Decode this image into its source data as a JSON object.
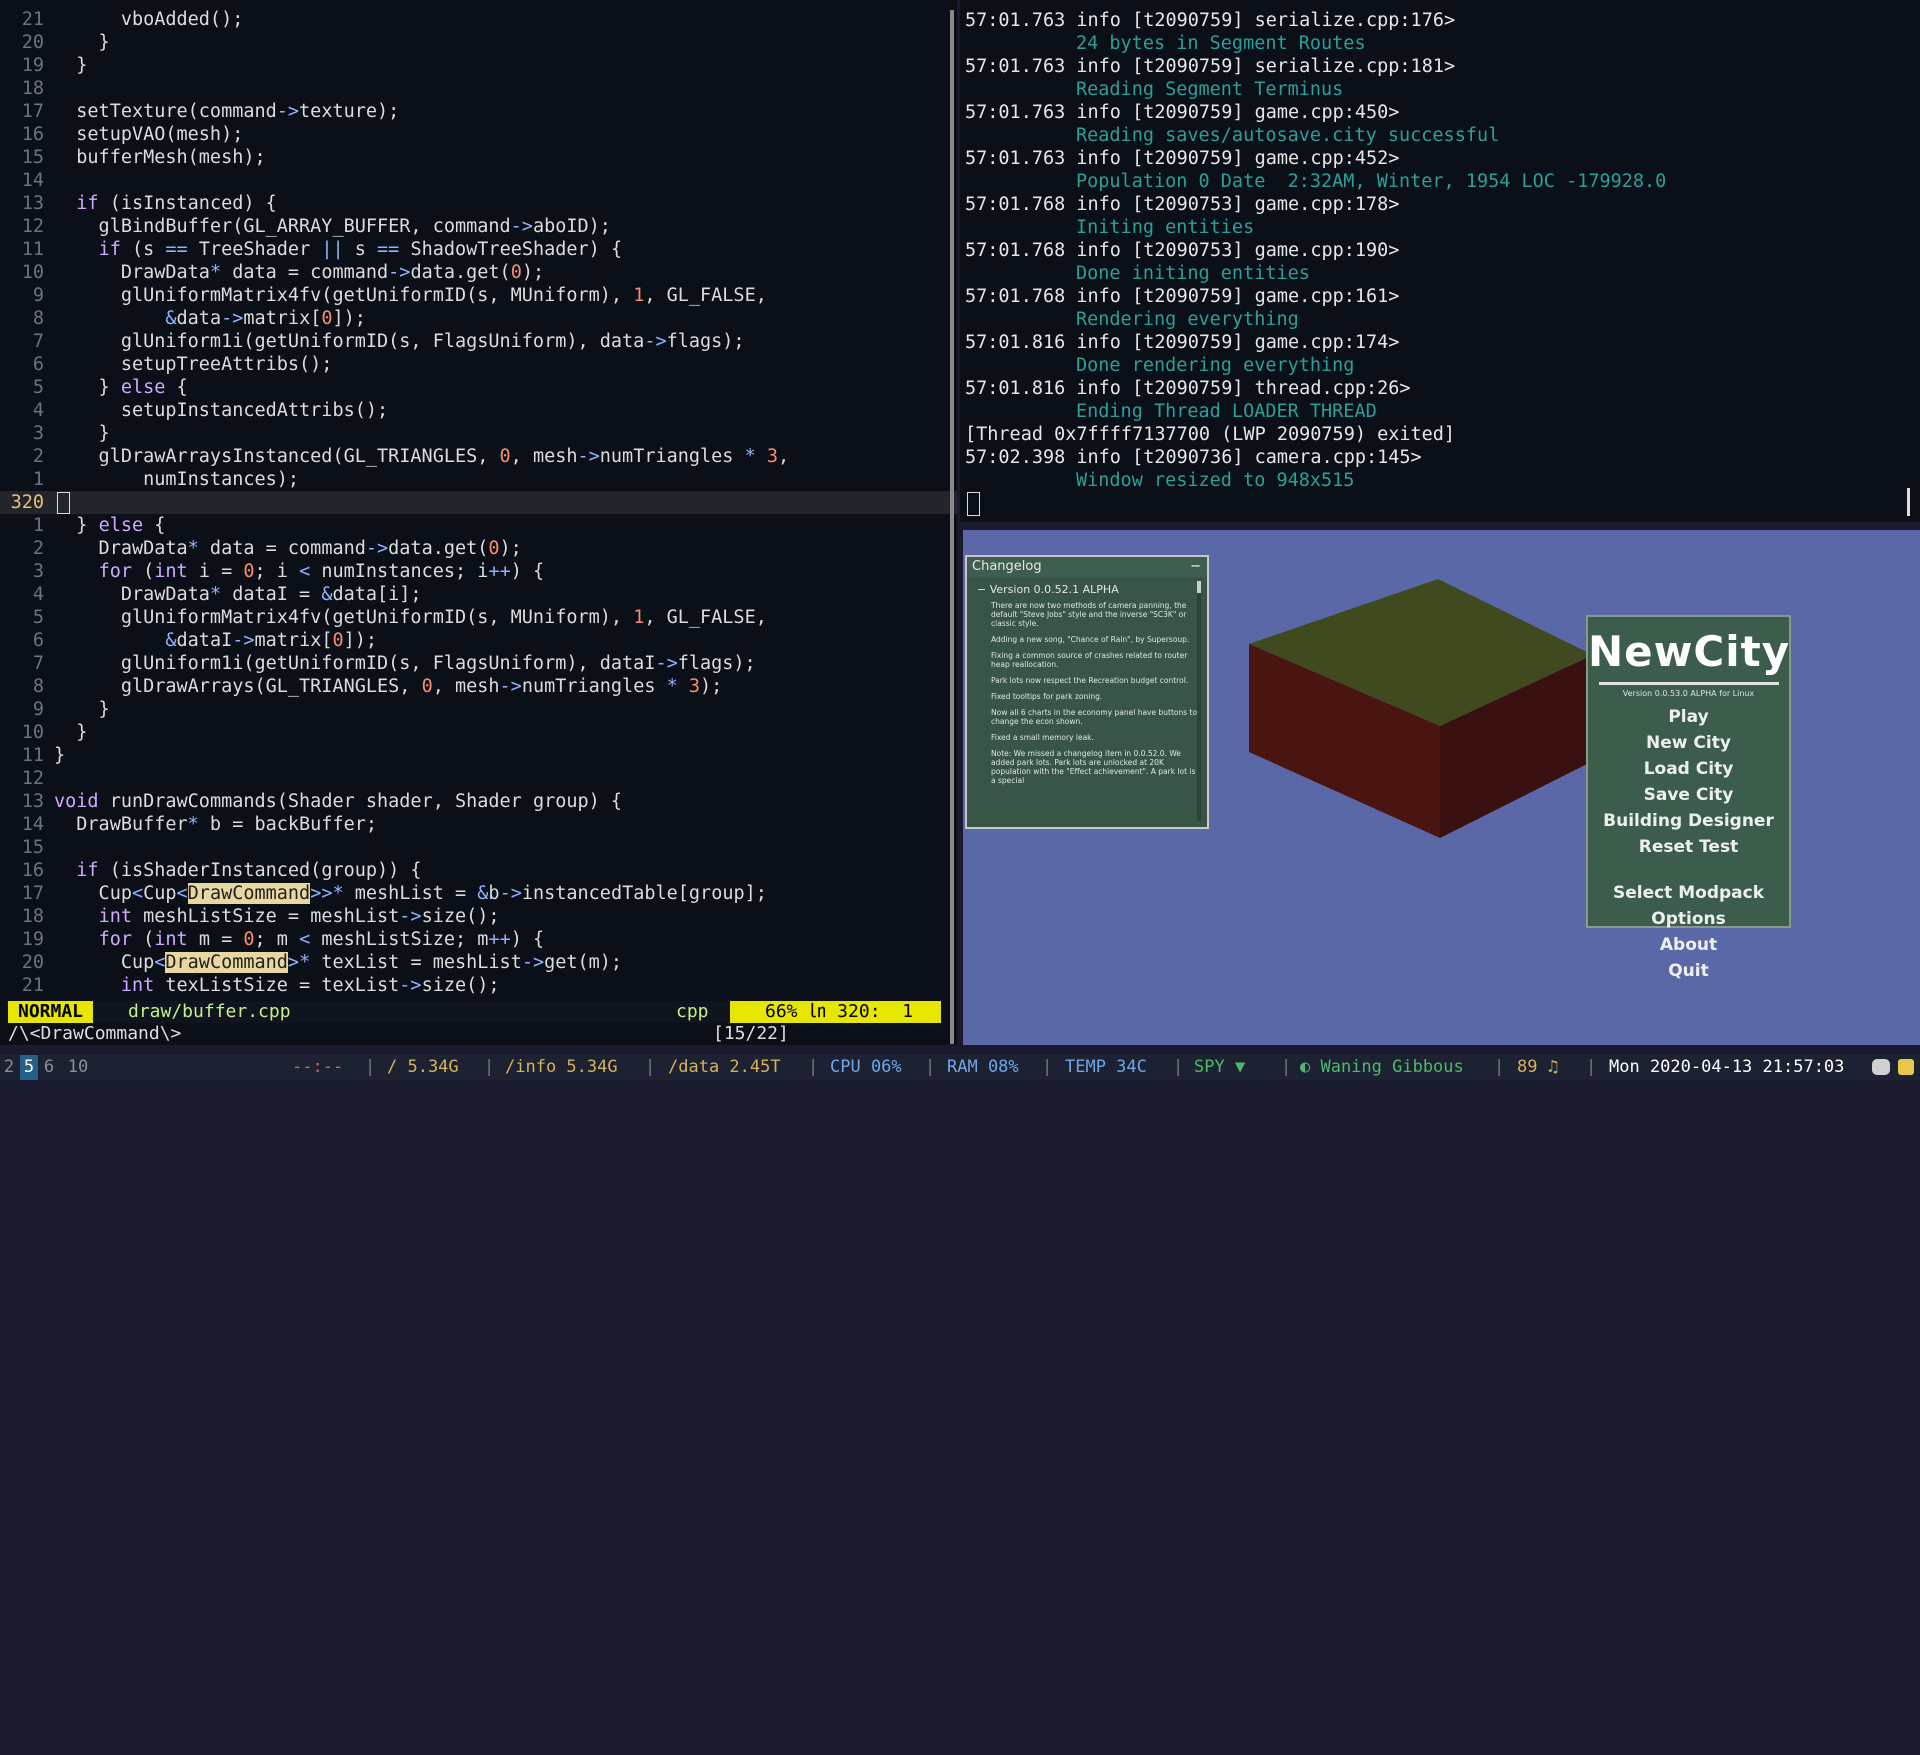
{
  "editor": {
    "lines": [
      {
        "n": "21",
        "code": "      vboAdded();"
      },
      {
        "n": "20",
        "code": "    }"
      },
      {
        "n": "19",
        "code": "  }"
      },
      {
        "n": "18",
        "code": ""
      },
      {
        "n": "17",
        "code": "  setTexture(command->texture);"
      },
      {
        "n": "16",
        "code": "  setupVAO(mesh);"
      },
      {
        "n": "15",
        "code": "  bufferMesh(mesh);"
      },
      {
        "n": "14",
        "code": ""
      },
      {
        "n": "13",
        "code": "  if (isInstanced) {"
      },
      {
        "n": "12",
        "code": "    glBindBuffer(GL_ARRAY_BUFFER, command->aboID);"
      },
      {
        "n": "11",
        "code": "    if (s == TreeShader || s == ShadowTreeShader) {"
      },
      {
        "n": "10",
        "code": "      DrawData* data = command->data.get(0);"
      },
      {
        "n": "9",
        "code": "      glUniformMatrix4fv(getUniformID(s, MUniform), 1, GL_FALSE,"
      },
      {
        "n": "8",
        "code": "          &data->matrix[0]);"
      },
      {
        "n": "7",
        "code": "      glUniform1i(getUniformID(s, FlagsUniform), data->flags);"
      },
      {
        "n": "6",
        "code": "      setupTreeAttribs();"
      },
      {
        "n": "5",
        "code": "    } else {"
      },
      {
        "n": "4",
        "code": "      setupInstancedAttribs();"
      },
      {
        "n": "3",
        "code": "    }"
      },
      {
        "n": "2",
        "code": "    glDrawArraysInstanced(GL_TRIANGLES, 0, mesh->numTriangles * 3,"
      },
      {
        "n": "1",
        "code": "        numInstances);"
      },
      {
        "n": "320",
        "code": "",
        "current": true
      },
      {
        "n": "1",
        "code": "  } else {"
      },
      {
        "n": "2",
        "code": "    DrawData* data = command->data.get(0);"
      },
      {
        "n": "3",
        "code": "    for (int i = 0; i < numInstances; i++) {"
      },
      {
        "n": "4",
        "code": "      DrawData* dataI = &data[i];"
      },
      {
        "n": "5",
        "code": "      glUniformMatrix4fv(getUniformID(s, MUniform), 1, GL_FALSE,"
      },
      {
        "n": "6",
        "code": "          &dataI->matrix[0]);"
      },
      {
        "n": "7",
        "code": "      glUniform1i(getUniformID(s, FlagsUniform), dataI->flags);"
      },
      {
        "n": "8",
        "code": "      glDrawArrays(GL_TRIANGLES, 0, mesh->numTriangles * 3);"
      },
      {
        "n": "9",
        "code": "    }"
      },
      {
        "n": "10",
        "code": "  }"
      },
      {
        "n": "11",
        "code": "}"
      },
      {
        "n": "12",
        "code": ""
      },
      {
        "n": "13",
        "code": "void runDrawCommands(Shader shader, Shader group) {"
      },
      {
        "n": "14",
        "code": "  DrawBuffer* b = backBuffer;"
      },
      {
        "n": "15",
        "code": ""
      },
      {
        "n": "16",
        "code": "  if (isShaderInstanced(group)) {"
      },
      {
        "n": "17",
        "code": "    Cup<Cup<DrawCommand>>* meshList = &b->instancedTable[group];"
      },
      {
        "n": "18",
        "code": "    int meshListSize = meshList->size();"
      },
      {
        "n": "19",
        "code": "    for (int m = 0; m < meshListSize; m++) {"
      },
      {
        "n": "20",
        "code": "      Cup<DrawCommand>* texList = meshList->get(m);"
      },
      {
        "n": "21",
        "code": "      int texListSize = texList->size();"
      }
    ],
    "highlight_term": "DrawCommand",
    "status": {
      "mode": "NORMAL",
      "file": "draw/buffer.cpp",
      "filetype": "cpp",
      "position": "66% ㏑ 320:  1"
    },
    "cmdline": "/\\<DrawCommand\\>",
    "match_count": "[15/22]"
  },
  "terminal": {
    "lines": [
      {
        "type": "log",
        "ts": "57:01.763",
        "lvl": "info",
        "tid": "[t2090759]",
        "src": "serialize.cpp:176>"
      },
      {
        "type": "msg",
        "text": "24 bytes in Segment Routes"
      },
      {
        "type": "log",
        "ts": "57:01.763",
        "lvl": "info",
        "tid": "[t2090759]",
        "src": "serialize.cpp:181>"
      },
      {
        "type": "msg",
        "text": "Reading Segment Terminus"
      },
      {
        "type": "log",
        "ts": "57:01.763",
        "lvl": "info",
        "tid": "[t2090759]",
        "src": "game.cpp:450>"
      },
      {
        "type": "msg",
        "text": "Reading saves/autosave.city successful"
      },
      {
        "type": "log",
        "ts": "57:01.763",
        "lvl": "info",
        "tid": "[t2090759]",
        "src": "game.cpp:452>"
      },
      {
        "type": "msg",
        "text": "Population 0 Date  2:32AM, Winter, 1954 LOC -179928.0"
      },
      {
        "type": "log",
        "ts": "57:01.768",
        "lvl": "info",
        "tid": "[t2090753]",
        "src": "game.cpp:178>"
      },
      {
        "type": "msg",
        "text": "Initing entities"
      },
      {
        "type": "log",
        "ts": "57:01.768",
        "lvl": "info",
        "tid": "[t2090753]",
        "src": "game.cpp:190>"
      },
      {
        "type": "msg",
        "text": "Done initing entities"
      },
      {
        "type": "log",
        "ts": "57:01.768",
        "lvl": "info",
        "tid": "[t2090759]",
        "src": "game.cpp:161>"
      },
      {
        "type": "msg",
        "text": "Rendering everything"
      },
      {
        "type": "log",
        "ts": "57:01.816",
        "lvl": "info",
        "tid": "[t2090759]",
        "src": "game.cpp:174>"
      },
      {
        "type": "msg",
        "text": "Done rendering everything"
      },
      {
        "type": "log",
        "ts": "57:01.816",
        "lvl": "info",
        "tid": "[t2090759]",
        "src": "thread.cpp:26>"
      },
      {
        "type": "msg",
        "text": "Ending Thread LOADER THREAD"
      },
      {
        "type": "thread",
        "text": "[Thread 0x7ffff7137700 (LWP 2090759) exited]"
      },
      {
        "type": "log",
        "ts": "57:02.398",
        "lvl": "info",
        "tid": "[t2090736]",
        "src": "camera.cpp:145>"
      },
      {
        "type": "msg",
        "text": "Window resized to 948x515"
      }
    ]
  },
  "game": {
    "changelog": {
      "title": "Changelog",
      "minimize": "−",
      "version": "− Version 0.0.52.1 ALPHA",
      "items": [
        "There are now two methods of camera panning, the default \"Steve Jobs\" style and the inverse \"SC3K\" or classic style.",
        "Adding a new song, \"Chance of Rain\", by Supersoup.",
        "Fixing a common source of crashes related to router heap reallocation.",
        "Park lots now respect the Recreation budget control.",
        "Fixed tooltips for park zoning.",
        "Now all 6 charts in the economy panel have buttons to change the econ shown.",
        "Fixed a small memory leak.",
        "Note: We missed a changelog item in 0.0.52.0. We added park lots. Park lots are unlocked at 20K population with the \"Effect achievement\". A park lot is a special"
      ]
    },
    "menu": {
      "title": "NewCity",
      "version": "Version 0.0.53.0 ALPHA for Linux",
      "items": [
        "Play",
        "New  City",
        "Load  City",
        "Save  City",
        "Building  Designer",
        "Reset  Test"
      ],
      "items2": [
        "Select  Modpack",
        "Options",
        "About",
        "Quit"
      ]
    },
    "colors": {
      "sky": "#5a68a8",
      "block_top": "#3f4a1e",
      "block_left": "#4a1410",
      "block_right": "#3a1010"
    }
  },
  "bar": {
    "workspaces": [
      "2",
      "5",
      "6",
      "10"
    ],
    "active_workspace": "5",
    "network": "--:--",
    "disk_root": "/ 5.34G",
    "disk_info": "/info 5.34G",
    "disk_data": "/data 2.45T",
    "cpu": "CPU 06%",
    "ram": "RAM 08%",
    "temp": "TEMP 34C",
    "spy": "SPY ▼",
    "moon": "◐ Waning Gibbous",
    "volume": "89 ♫",
    "datetime": "Mon 2020-04-13 21:57:03",
    "tray_icons": [
      "discord-icon",
      "tray-app-icon"
    ]
  }
}
